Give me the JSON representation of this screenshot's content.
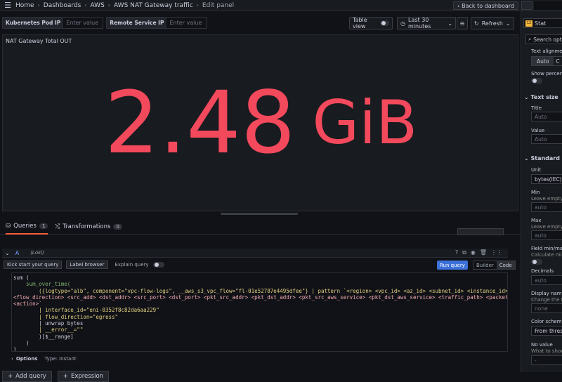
{
  "topbar": {
    "crumbs": [
      "Home",
      "Dashboards",
      "AWS",
      "AWS NAT Gateway traffic",
      "Edit panel"
    ],
    "back_label": "Back to dashboard"
  },
  "variables": [
    {
      "label": "Kubernetes Pod IP",
      "placeholder": "Enter value"
    },
    {
      "label": "Remote Service IP",
      "placeholder": "Enter value"
    }
  ],
  "controls": {
    "table_view": "Table view",
    "time_range": "Last 30 minutes",
    "refresh": "Refresh"
  },
  "panel": {
    "title": "NAT Gateway Total OUT",
    "value": "2.48",
    "unit": "GiB",
    "color": "#f2495c"
  },
  "tabs": [
    {
      "label": "Queries",
      "count": "1"
    },
    {
      "label": "Transformations",
      "count": "0"
    }
  ],
  "query": {
    "ref": "A",
    "datasource": "(Loki)",
    "kick_start": "Kick start your query",
    "label_browser": "Label browser",
    "explain": "Explain query",
    "run": "Run query",
    "modes": [
      "Builder",
      "Code"
    ],
    "lines": [
      "sum (",
      "    sum_over_time(",
      "        ({logtype=\"alb\", component=\"vpc-flow-logs\", __aws_s3_vpc_flow=\"fl-01e52787e4495dfee\"} | pattern `<region> <vpc_id> <az_id> <subnet_id> <instance_id> <interface_id>",
      "<flow_direction> <src_add> <dst_addr> <src_port> <dst_port> <pkt_src_addr> <pkt_dst_addr> <pkt_src_aws_service> <pkt_dst_aws_service> <traffic_path> <packets> <bytes>",
      "<action>`",
      "        | interface_id=\"eni-0352f8c82da6aa229\"",
      "        | flow_direction=\"egress\"",
      "        | unwrap bytes",
      "        | __error__=\"\"",
      "        )[$__range]",
      "    )",
      ")"
    ],
    "options_label": "Options",
    "options_value": "Type: Instant"
  },
  "add_buttons": [
    "Add query",
    "Expression"
  ],
  "sidebar": {
    "viz": "Stat",
    "search": "Search option",
    "text_alignment": "Text alignment",
    "auto": "Auto",
    "show_percent": "Show percent c",
    "text_size": "Text size",
    "title_label": "Title",
    "title_placeholder": "Auto",
    "value_label": "Value",
    "value_placeholder": "Auto",
    "standard_options": "Standard optio",
    "unit_label": "Unit",
    "unit_value": "bytes(IEC)",
    "min_label": "Min",
    "min_hint": "Leave empty to",
    "min_placeholder": "auto",
    "max_label": "Max",
    "max_hint": "Leave empty to",
    "max_placeholder": "auto",
    "field_minmax": "Field min/max",
    "field_minmax_hint": "Calculate min m",
    "decimals_label": "Decimals",
    "decimals_placeholder": "auto",
    "display_name": "Display name",
    "display_name_hint": "Change the field",
    "display_name_placeholder": "none",
    "color_scheme": "Color scheme",
    "color_scheme_value": "From thresho",
    "no_value": "No value",
    "no_value_hint": "What to show w",
    "no_value_placeholder": "-"
  }
}
